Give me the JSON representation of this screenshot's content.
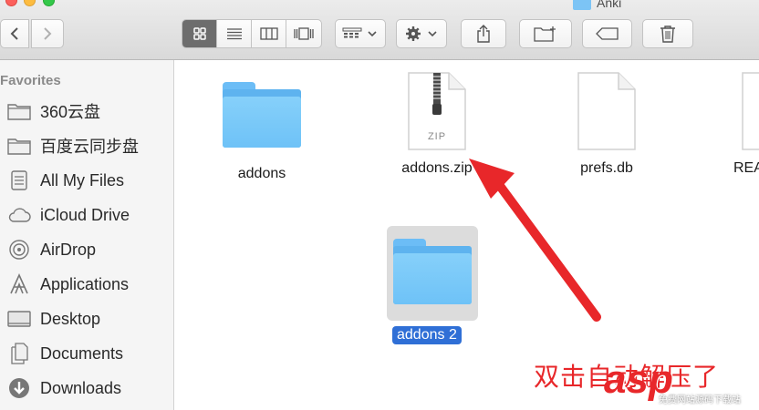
{
  "window": {
    "title": "Anki"
  },
  "sidebar": {
    "heading": "Favorites",
    "items": [
      {
        "label": "360云盘",
        "icon": "folder-icon"
      },
      {
        "label": "百度云同步盘",
        "icon": "folder-icon"
      },
      {
        "label": "All My Files",
        "icon": "all-files-icon"
      },
      {
        "label": "iCloud Drive",
        "icon": "cloud-icon"
      },
      {
        "label": "AirDrop",
        "icon": "airdrop-icon"
      },
      {
        "label": "Applications",
        "icon": "applications-icon"
      },
      {
        "label": "Desktop",
        "icon": "desktop-icon"
      },
      {
        "label": "Documents",
        "icon": "documents-icon"
      },
      {
        "label": "Downloads",
        "icon": "downloads-icon"
      }
    ]
  },
  "files": [
    {
      "name": "addons",
      "kind": "folder"
    },
    {
      "name": "addons.zip",
      "kind": "zip",
      "badge": "ZIP"
    },
    {
      "name": "prefs.db",
      "kind": "document"
    },
    {
      "name": "REA",
      "kind": "document"
    },
    {
      "name": "addons 2",
      "kind": "folder",
      "selected": true
    }
  ],
  "annotation": {
    "text": "双击自动解压了"
  },
  "watermark": {
    "logo": "asp",
    "sub": "免费网站源码下载站"
  },
  "colors": {
    "accent": "#2f6fd6",
    "arrow": "#e8272a",
    "folder": "#6ec2f7"
  }
}
